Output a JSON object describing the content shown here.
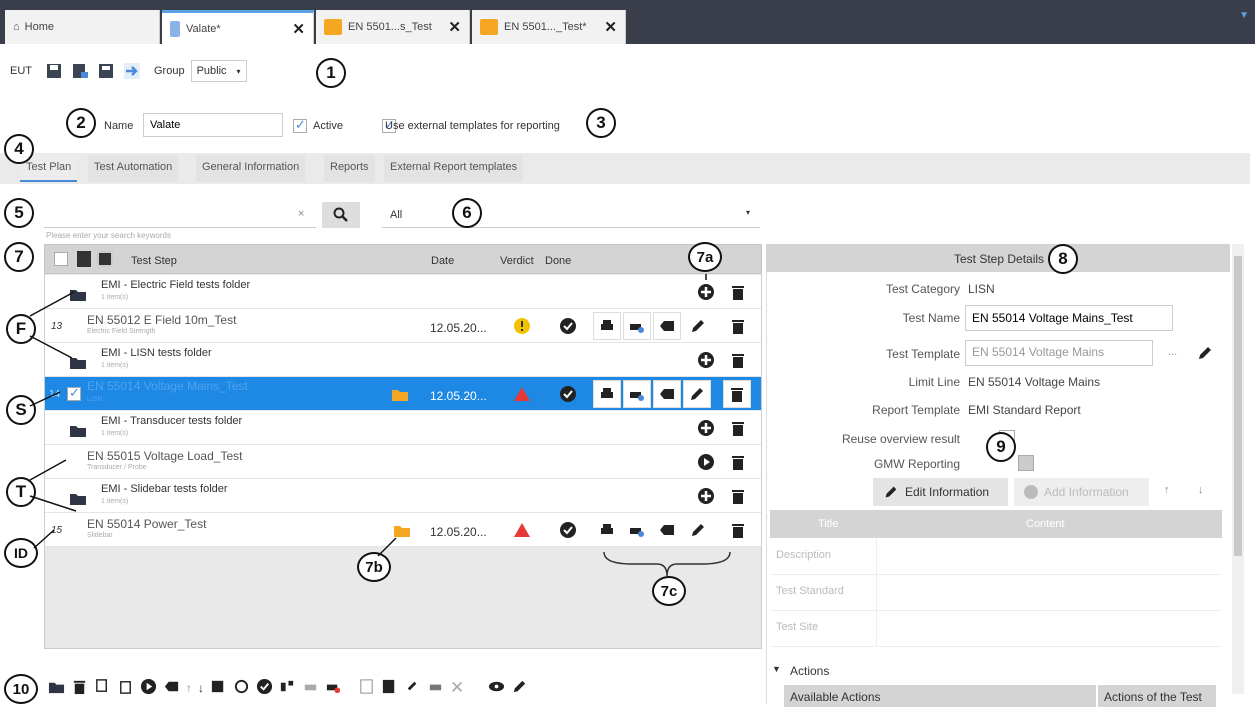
{
  "window_tabs": [
    {
      "label": "Home",
      "icon": "home-icon"
    },
    {
      "label": "Valate*",
      "icon": "document-icon"
    },
    {
      "label": "EN 5501...s_Test",
      "icon": "chart-icon"
    },
    {
      "label": "EN 5501..._Test*",
      "icon": "chart-icon"
    }
  ],
  "toolbar": {
    "eut": "EUT",
    "group_label": "Group",
    "group_value": "Public"
  },
  "name_row": {
    "name_label": "Name",
    "name_value": "Valate",
    "active_label": "Active",
    "external_label": "Use external templates for reporting"
  },
  "subtabs": [
    "Test Plan",
    "Test Automation",
    "General Information",
    "Reports",
    "External Report templates"
  ],
  "search": {
    "placeholder": "Please enter your search keywords",
    "clear": "×",
    "filter_value": "All"
  },
  "table": {
    "headers": {
      "step": "Test Step",
      "date": "Date",
      "verdict": "Verdict",
      "done": "Done"
    },
    "rows": [
      {
        "name": "EMI - Electric Field tests folder",
        "sub": "1 item(s)",
        "id": "",
        "date": ""
      },
      {
        "name": "EN 55012 E Field 10m_Test",
        "sub": "Electric Field Strength",
        "id": "13",
        "date": "12.05.20..."
      },
      {
        "name": "EMI - LISN tests folder",
        "sub": "1 item(s)",
        "id": "",
        "date": ""
      },
      {
        "name": "EN 55014 Voltage Mains_Test",
        "sub": "LISN",
        "id": "14",
        "date": "12.05.20..."
      },
      {
        "name": "EMI - Transducer tests folder",
        "sub": "1 item(s)",
        "id": "",
        "date": ""
      },
      {
        "name": "EN 55015 Voltage Load_Test",
        "sub": "Transducer / Probe",
        "id": "",
        "date": ""
      },
      {
        "name": "EMI - Slidebar tests folder",
        "sub": "1 item(s)",
        "id": "",
        "date": ""
      },
      {
        "name": "EN 55014 Power_Test",
        "sub": "Slidebar",
        "id": "15",
        "date": "12.05.20..."
      }
    ]
  },
  "details": {
    "title": "Test Step Details",
    "category_label": "Test Category",
    "category_value": "LISN",
    "name_label": "Test Name",
    "name_value": "EN 55014 Voltage Mains_Test",
    "template_label": "Test Template",
    "template_value": "EN 55014 Voltage Mains",
    "template_more": "...",
    "limit_label": "Limit Line",
    "limit_value": "EN 55014 Voltage Mains",
    "report_label": "Report Template",
    "report_value": "EMI Standard Report",
    "reuse_label": "Reuse overview result",
    "gmw_label": "GMW Reporting",
    "edit_btn": "Edit Information",
    "add_btn": "Add Information",
    "col_title": "Title",
    "col_content": "Content",
    "grid_rows": [
      "Description",
      "Test Standard",
      "Test Site"
    ],
    "actions_label": "Actions",
    "available_actions": "Available Actions",
    "test_actions": "Actions of the Test"
  },
  "callouts": {
    "c1": "1",
    "c2": "2",
    "c3": "3",
    "c4": "4",
    "c5": "5",
    "c6": "6",
    "c7": "7",
    "c7a": "7a",
    "c7b": "7b",
    "c7c": "7c",
    "c8": "8",
    "c9": "9",
    "c10": "10",
    "cF": "F",
    "cS": "S",
    "cT": "T",
    "cID": "ID"
  },
  "colors": {
    "accent": "#1e88e5",
    "titlebar": "#3a3d4a",
    "warning": "#f2c100",
    "fail": "#e53935"
  }
}
